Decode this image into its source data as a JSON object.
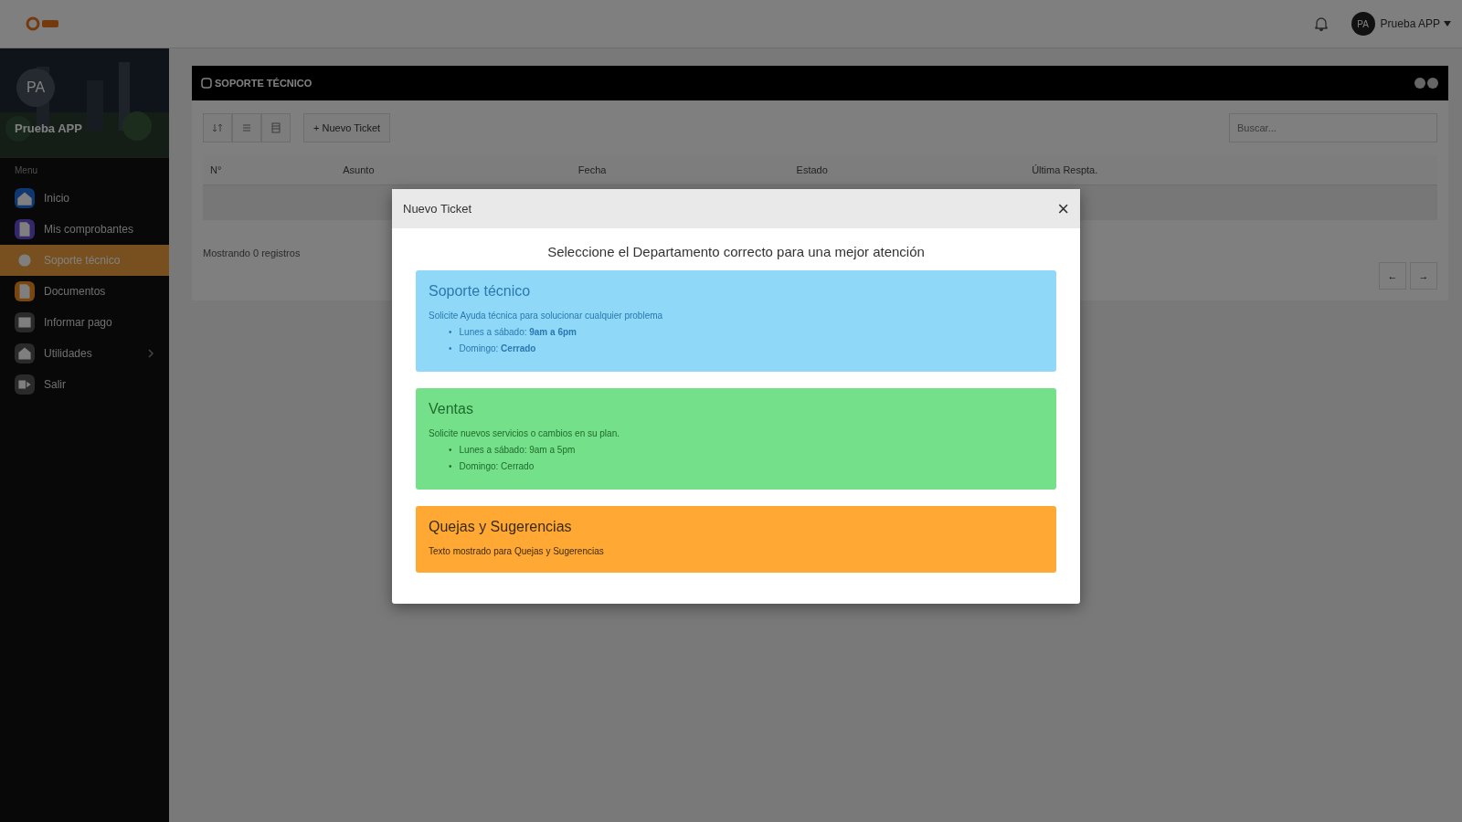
{
  "topbar": {
    "user_name": "Prueba APP",
    "avatar_initials": "PA"
  },
  "sidebar": {
    "avatar_initials": "PA",
    "user_name": "Prueba APP",
    "menu_label": "Menu",
    "items": [
      {
        "label": "Inicio",
        "selected": false,
        "expandable": false
      },
      {
        "label": "Mis comprobantes",
        "selected": false,
        "expandable": false
      },
      {
        "label": "Soporte técnico",
        "selected": true,
        "expandable": false
      },
      {
        "label": "Documentos",
        "selected": false,
        "expandable": false
      },
      {
        "label": "Informar pago",
        "selected": false,
        "expandable": false
      },
      {
        "label": "Utilidades",
        "selected": false,
        "expandable": true
      },
      {
        "label": "Salir",
        "selected": false,
        "expandable": false
      }
    ]
  },
  "panel": {
    "title": "SOPORTE TÉCNICO",
    "new_button": "+ Nuevo Ticket",
    "search_placeholder": "Buscar...",
    "columns": [
      "N°",
      "Asunto",
      "Fecha",
      "Estado",
      "Última Respta."
    ],
    "footer": "Mostrando 0 registros",
    "pager": [
      "←",
      "→"
    ]
  },
  "dialog": {
    "title": "Nuevo Ticket",
    "close": "×",
    "prompt": "Seleccione el Departamento correcto para una mejor atención",
    "departments": [
      {
        "title": "Soporte técnico",
        "color": "#8fd8f8",
        "description": "Solicite Ayuda técnica para solucionar cualquier problema",
        "hours": [
          {
            "bullet": "•",
            "text": "Lunes a sábado: **9am a 6pm**"
          },
          {
            "bullet": "•",
            "text": "Domingo: **Cerrado**"
          }
        ]
      },
      {
        "title": "Ventas",
        "color": "#74e08a",
        "description": "Solicite nuevos servicios o cambios en su plan.",
        "hours": [
          {
            "bullet": "•",
            "text": "Lunes a sábado: 9am a 5pm"
          },
          {
            "bullet": "•",
            "text": "Domingo: Cerrado"
          }
        ]
      },
      {
        "title": "Quejas y Sugerencias",
        "color": "#ffa834",
        "description": "Texto mostrado para Quejas y Sugerencias"
      }
    ]
  }
}
